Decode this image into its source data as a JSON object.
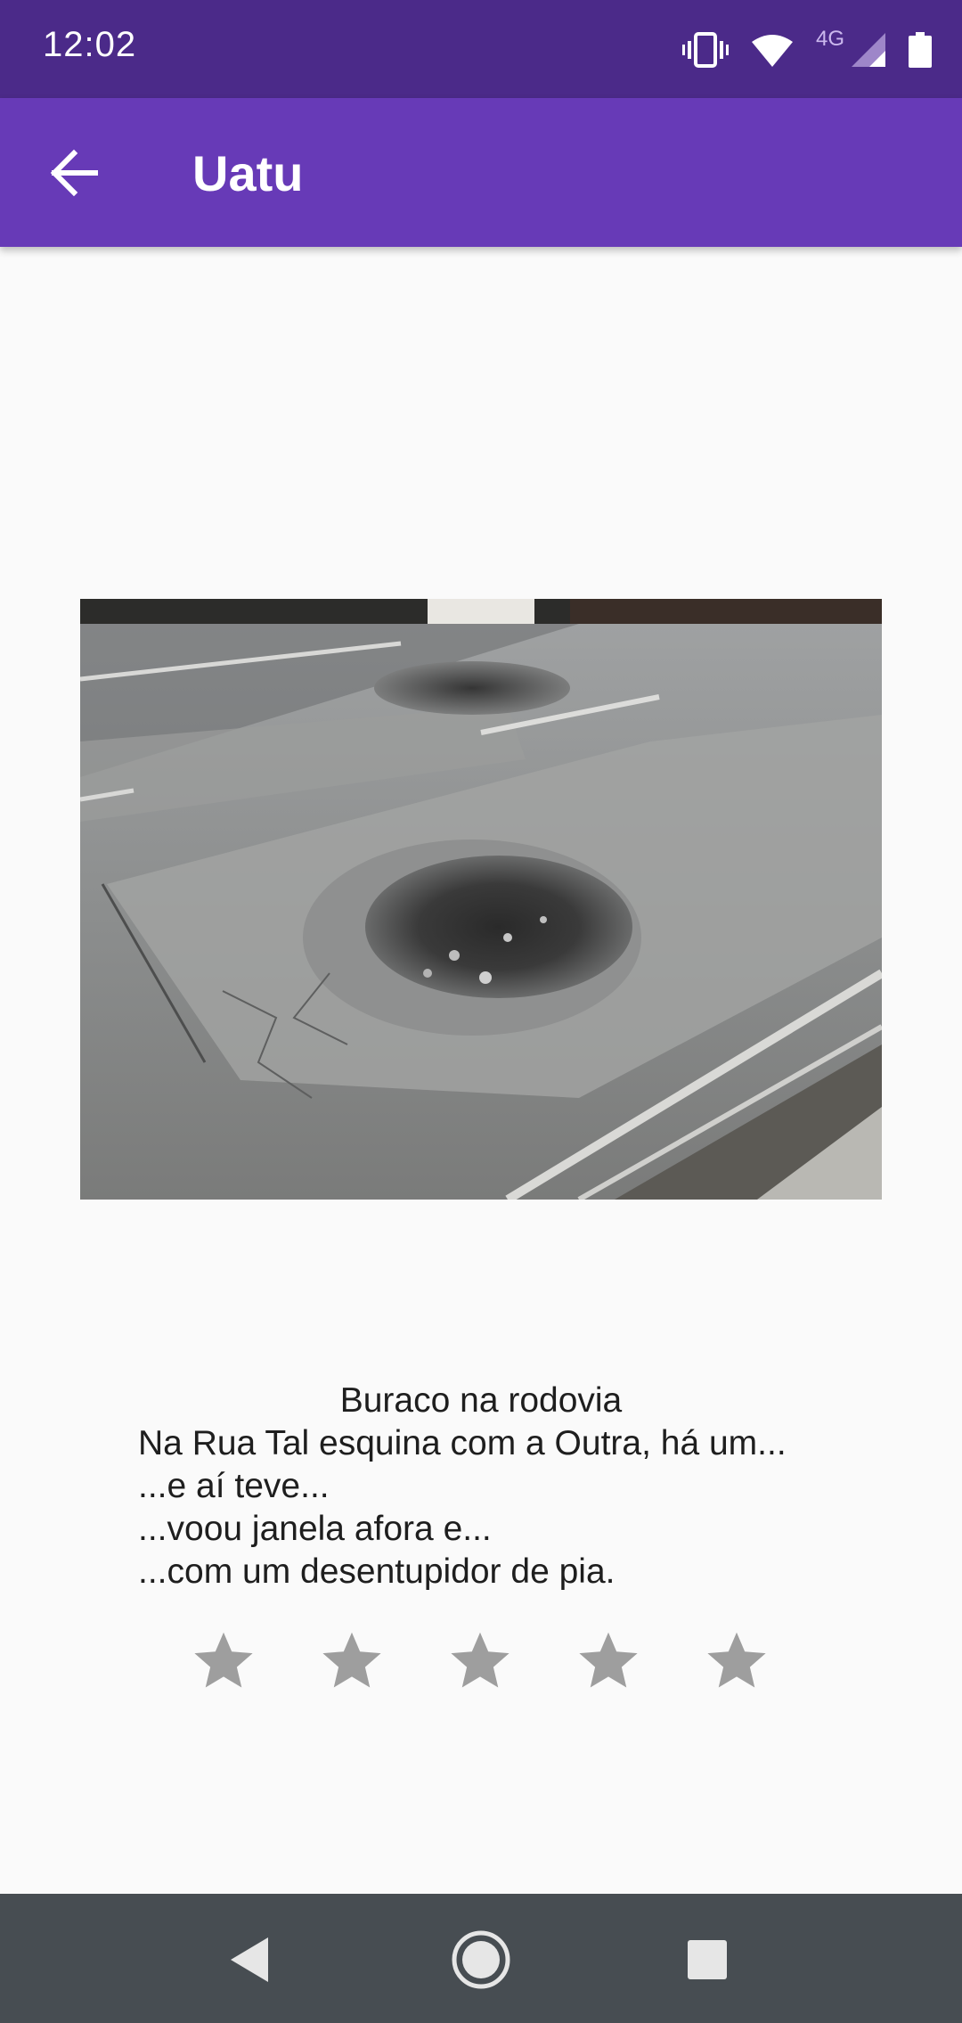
{
  "status_bar": {
    "time": "12:02",
    "network_label": "4G",
    "icons": [
      "vibrate-icon",
      "wifi-icon",
      "cell-signal-icon",
      "battery-icon"
    ]
  },
  "app_bar": {
    "title": "Uatu",
    "back_icon": "arrow-back-icon"
  },
  "report": {
    "image_subject": "pothole in road",
    "title": "Buraco na rodovia",
    "description_lines": [
      "Na Rua Tal esquina com a Outra, há um...",
      "...e aí teve...",
      "...voou janela afora e...",
      "...com um desentupidor de pia."
    ]
  },
  "rating": {
    "max": 5,
    "value": 0,
    "star_color": "#9e9e9e"
  },
  "nav_bar": {
    "buttons": [
      "back-icon",
      "home-icon",
      "recents-icon"
    ]
  },
  "colors": {
    "status_bar": "#4b2a89",
    "app_bar": "#673ab7",
    "background": "#fafafa",
    "nav_bar": "#474d52"
  }
}
